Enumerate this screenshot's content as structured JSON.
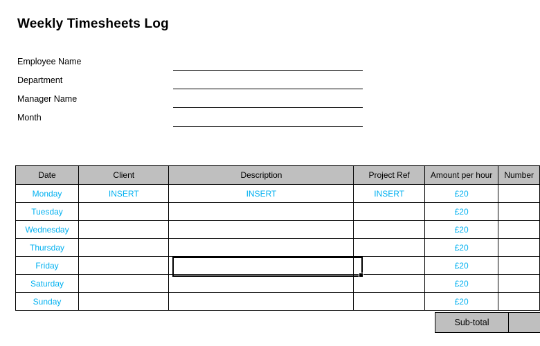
{
  "document": {
    "title": "Weekly Timesheets Log"
  },
  "form": {
    "fields": [
      {
        "label": "Employee Name",
        "value": ""
      },
      {
        "label": "Department",
        "value": ""
      },
      {
        "label": "Manager Name",
        "value": ""
      },
      {
        "label": "Month",
        "value": ""
      }
    ]
  },
  "table": {
    "headers": [
      "Date",
      "Client",
      "Description",
      "Project Ref",
      "Amount per hour",
      "Number"
    ],
    "rows": [
      {
        "date": "Monday",
        "client": "INSERT",
        "description": "INSERT",
        "project_ref": "INSERT",
        "amount_per_hour": "£20",
        "number": ""
      },
      {
        "date": "Tuesday",
        "client": "",
        "description": "",
        "project_ref": "",
        "amount_per_hour": "£20",
        "number": ""
      },
      {
        "date": "Wednesday",
        "client": "",
        "description": "",
        "project_ref": "",
        "amount_per_hour": "£20",
        "number": ""
      },
      {
        "date": "Thursday",
        "client": "",
        "description": "",
        "project_ref": "",
        "amount_per_hour": "£20",
        "number": ""
      },
      {
        "date": "Friday",
        "client": "",
        "description": "",
        "project_ref": "",
        "amount_per_hour": "£20",
        "number": ""
      },
      {
        "date": "Saturday",
        "client": "",
        "description": "",
        "project_ref": "",
        "amount_per_hour": "£20",
        "number": ""
      },
      {
        "date": "Sunday",
        "client": "",
        "description": "",
        "project_ref": "",
        "amount_per_hour": "£20",
        "number": ""
      }
    ],
    "subtotal": {
      "label": "Sub-total",
      "value": ""
    },
    "selected_cell": {
      "row": "Friday",
      "column": "Description"
    }
  },
  "colors": {
    "header_fill": "#BFBFBF",
    "entry_text": "#00B0F0",
    "grid_line": "#000000"
  }
}
